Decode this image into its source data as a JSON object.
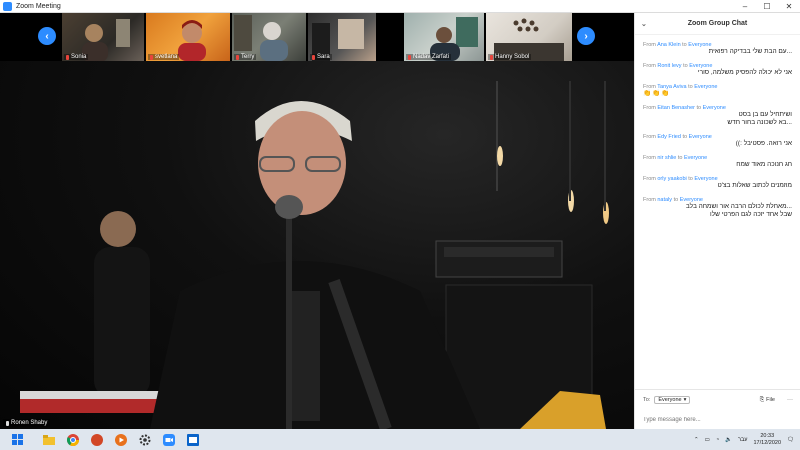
{
  "window": {
    "title": "Zoom Meeting",
    "minimize": "–",
    "maximize": "☐",
    "close": "✕"
  },
  "participants": [
    {
      "name": "Sonia"
    },
    {
      "name": "svetlana"
    },
    {
      "name": "Terry"
    },
    {
      "name": "Sara"
    },
    {
      "name": "Nadav Zarfati"
    },
    {
      "name": "Hanny Sobol"
    }
  ],
  "gallery_nav": {
    "prev": "‹",
    "next": "›"
  },
  "active_speaker": {
    "name": "Ronen Shaby"
  },
  "chat": {
    "title": "Zoom Group Chat",
    "collapse": "⌄",
    "messages": [
      {
        "from_label": "From",
        "sender": "Ana Klein",
        "to_label": "to",
        "recipient": "Everyone",
        "text": "...עם הבת שלי בבדיקה רפואית"
      },
      {
        "from_label": "From",
        "sender": "Ronit levy",
        "to_label": "to",
        "recipient": "Everyone",
        "text": "אני לא יכולה להפסיק משלמה, סורי"
      },
      {
        "from_label": "From",
        "sender": "Tanya Aviva",
        "to_label": "to",
        "recipient": "Everyone",
        "text": "👏👏👏"
      },
      {
        "from_label": "From",
        "sender": "Eitan Benasher",
        "to_label": "to",
        "recipient": "Everyone",
        "text": "ושיתחיל עם בן בסט\n...בא לשכונה בחור חדש"
      },
      {
        "from_label": "From",
        "sender": "Edy Fried",
        "to_label": "to",
        "recipient": "Everyone",
        "text": "אני רואה. פסטיבל :))"
      },
      {
        "from_label": "From",
        "sender": "nir shlie",
        "to_label": "to",
        "recipient": "Everyone",
        "text": "חג חנוכה מאוד שמח"
      },
      {
        "from_label": "From",
        "sender": "orly yaakobi",
        "to_label": "to",
        "recipient": "Everyone",
        "text": "מוזמנים לכתוב שאלות בצ'ט"
      },
      {
        "from_label": "From",
        "sender": "nataly",
        "to_label": "to",
        "recipient": "Everyone",
        "text": "...מאחלת לכולם הרבה אור ושמחה בלב\nשבל אחד יזכה לגם הפרטי שלו"
      }
    ],
    "to_label": "To:",
    "to_value": "Everyone",
    "file_label": "File",
    "more": "···",
    "input_placeholder": "Type message here..."
  },
  "taskbar": {
    "lang": "עבר",
    "time": "20:33",
    "date": "17/12/2020"
  },
  "colors": {
    "accent": "#2d8cff",
    "mic_muted": "#e8453c"
  }
}
